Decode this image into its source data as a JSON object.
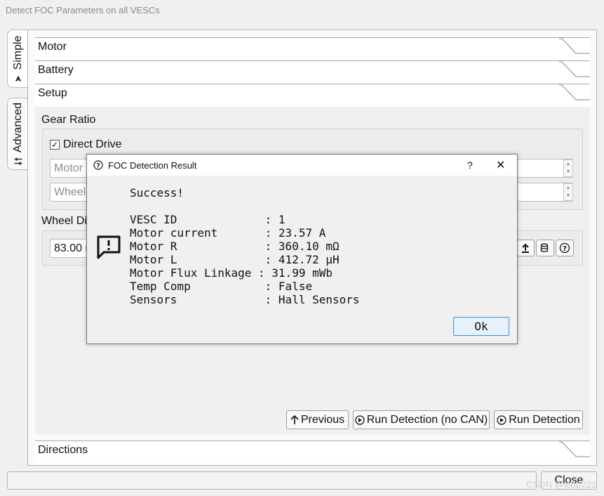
{
  "window": {
    "title": "Detect FOC Parameters on all VESCs"
  },
  "tabs": [
    {
      "label": "Simple",
      "icon": "simple-mode-icon",
      "active": true
    },
    {
      "label": "Advanced",
      "icon": "sliders-icon",
      "active": false
    }
  ],
  "sections": {
    "motor": "Motor",
    "battery": "Battery",
    "setup": "Setup",
    "directions": "Directions"
  },
  "setup": {
    "gear_ratio_label": "Gear Ratio",
    "direct_drive_label": "Direct Drive",
    "direct_drive_checked": true,
    "checkmark": "✓",
    "motor_field": "Motor",
    "wheel_field": "Wheel",
    "wheel_diameter_label": "Wheel Dia",
    "wheel_diameter_value": "83.00 r",
    "spin_up": "▲",
    "spin_down": "▼"
  },
  "actions": {
    "previous": "Previous",
    "run_no_can": "Run Detection (no CAN)",
    "run": "Run Detection"
  },
  "dialog": {
    "title": "FOC Detection Result",
    "help": "?",
    "close": "✕",
    "lines": [
      "Success!",
      "",
      "VESC ID             : 1",
      "Motor current       : 23.57 A",
      "Motor R             : 360.10 mΩ",
      "Motor L             : 412.72 µH",
      "Motor Flux Linkage : 31.99 mWb",
      "Temp Comp           : False",
      "Sensors             : Hall Sensors"
    ],
    "ok": "Ok"
  },
  "footer": {
    "close": "Close"
  },
  "watermark": "CSDN @loop222"
}
